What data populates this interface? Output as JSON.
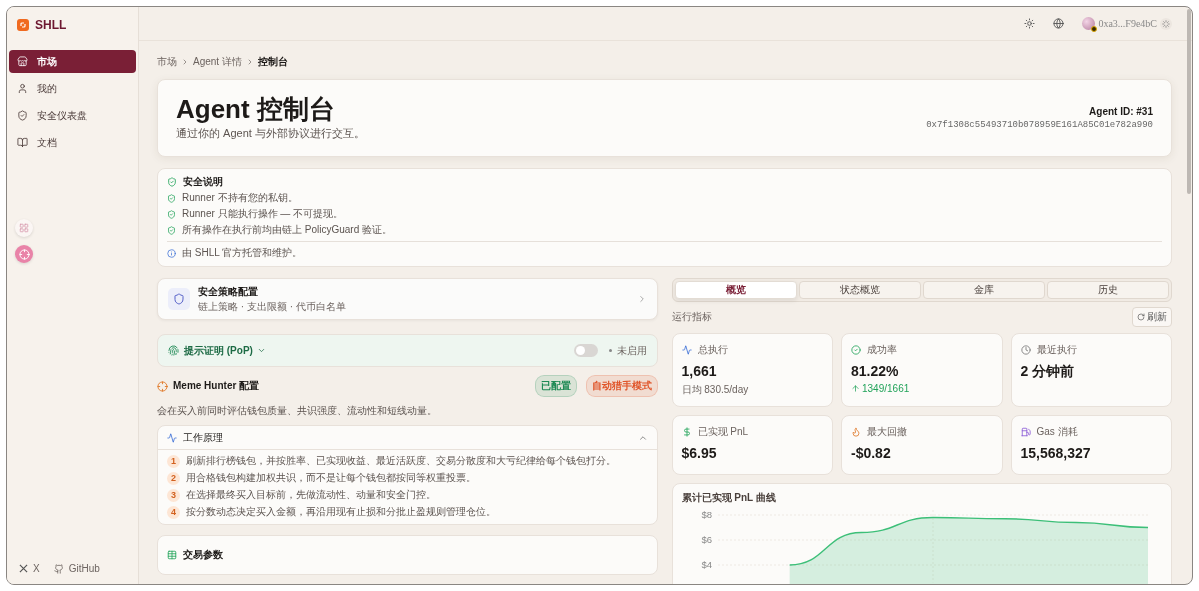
{
  "sidebar": {
    "brand": "SHLL",
    "items": [
      {
        "label": "市场",
        "selected": true
      },
      {
        "label": "我的",
        "selected": false
      },
      {
        "label": "安全仪表盘",
        "selected": false
      },
      {
        "label": "文档",
        "selected": false
      }
    ],
    "footer_links": [
      {
        "label": "X"
      },
      {
        "label": "GitHub"
      }
    ]
  },
  "topbar": {
    "wallet_address": "0xa3...F9e4bC"
  },
  "breadcrumbs": [
    "市场",
    "Agent 详情",
    "控制台"
  ],
  "header": {
    "title": "Agent 控制台",
    "subtitle": "通过你的 Agent 与外部协议进行交互。",
    "agent_id": "Agent ID: #31",
    "address": "0x7f1308c55493710b078959E161A85C01e782a990"
  },
  "security_notice": {
    "title": "安全说明",
    "points": [
      "Runner 不持有您的私钥。",
      "Runner 只能执行操作 — 不可提现。",
      "所有操作在执行前均由链上 PolicyGuard 验证。"
    ],
    "footer": "由 SHLL 官方托管和维护。"
  },
  "policy_card": {
    "title": "安全策略配置",
    "subtitle": "链上策略 · 支出限额 · 代币白名单"
  },
  "proof": {
    "title": "提示证明 (PoP)",
    "expanded": false,
    "on": false,
    "status": "未启用"
  },
  "meme_hunter": {
    "title": "Meme Hunter 配置",
    "badges": [
      {
        "label": "已配置",
        "color": "#1f8a55"
      },
      {
        "label": "自动猎手模式",
        "color": "#e0552a"
      }
    ],
    "description": "会在买入前同时评估钱包质量、共识强度、流动性和短线动量。",
    "how_it_works": {
      "title": "工作原理",
      "expanded": true,
      "steps": [
        {
          "number": "1",
          "text": "刷新排行榜钱包，并按胜率、已实现收益、最近活跃度、交易分散度和大亏纪律给每个钱包打分。"
        },
        {
          "number": "2",
          "text": "用合格钱包构建加权共识，而不是让每个钱包都按同等权重投票。"
        },
        {
          "number": "3",
          "text": "在选择最终买入目标前，先做流动性、动量和安全门控。"
        },
        {
          "number": "4",
          "text": "按分数动态决定买入金额，再沿用现有止损和分批止盈规则管理仓位。"
        }
      ]
    }
  },
  "trade_params": {
    "title": "交易参数"
  },
  "tabs": [
    {
      "label": "概览",
      "selected": true
    },
    {
      "label": "状态概览",
      "selected": false
    },
    {
      "label": "金库",
      "selected": false
    },
    {
      "label": "历史",
      "selected": false
    }
  ],
  "metrics": {
    "title": "运行指标",
    "refresh": "刷新",
    "cards": [
      {
        "label": "总执行",
        "value": "1,661",
        "sub": "日均 830.5/day",
        "kind": "plain"
      },
      {
        "label": "成功率",
        "value": "81.22%",
        "sub": "1349/1661",
        "kind": "trend"
      },
      {
        "label": "最近执行",
        "value": "2 分钟前"
      },
      {
        "label": "已实现 PnL",
        "value": "$6.95"
      },
      {
        "label": "最大回撤",
        "value": "-$0.82"
      },
      {
        "label": "Gas 消耗",
        "value": "15,568,327"
      }
    ]
  },
  "pnl_chart": {
    "title": "累计已实现 PnL 曲线",
    "chart_data": {
      "type": "area",
      "grid": true,
      "series": [
        {
          "color": "#3cbf78",
          "values": [
            null,
            4.0,
            6.6,
            7.8,
            7.7,
            7.4,
            7.0
          ]
        }
      ],
      "ylim": [
        2.6,
        8.4
      ],
      "yticks": [
        {
          "value": 4,
          "label": "$4"
        },
        {
          "value": 6,
          "label": "$6"
        },
        {
          "value": 8,
          "label": "$8"
        }
      ]
    }
  }
}
